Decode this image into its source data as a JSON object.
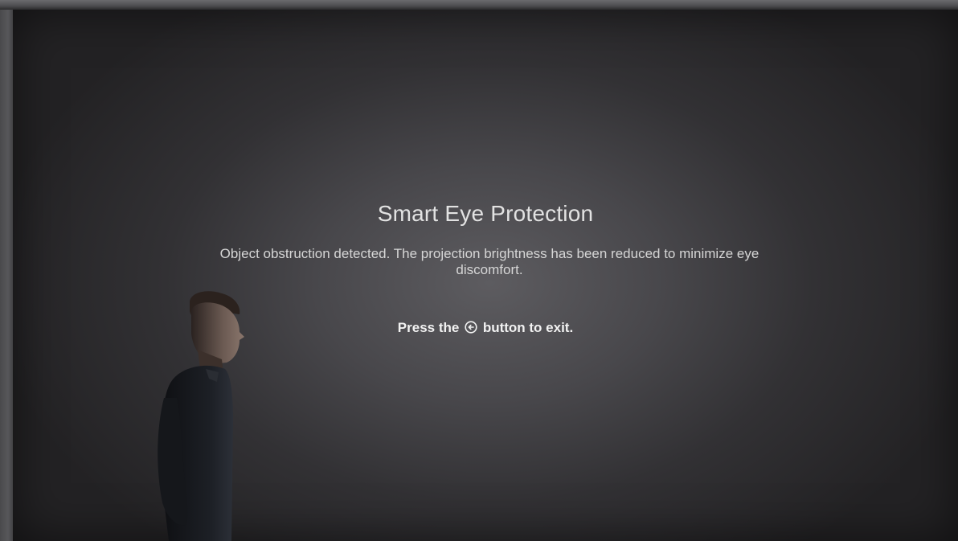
{
  "dialog": {
    "title": "Smart Eye Protection",
    "message": "Object obstruction detected. The projection brightness has been reduced to minimize eye discomfort.",
    "instruction_prefix": "Press the",
    "instruction_icon": "back-icon",
    "instruction_suffix": "button to exit."
  },
  "colors": {
    "screen_center": "#5d5c60",
    "screen_edge": "#232224",
    "text": "#dcdcdc"
  }
}
